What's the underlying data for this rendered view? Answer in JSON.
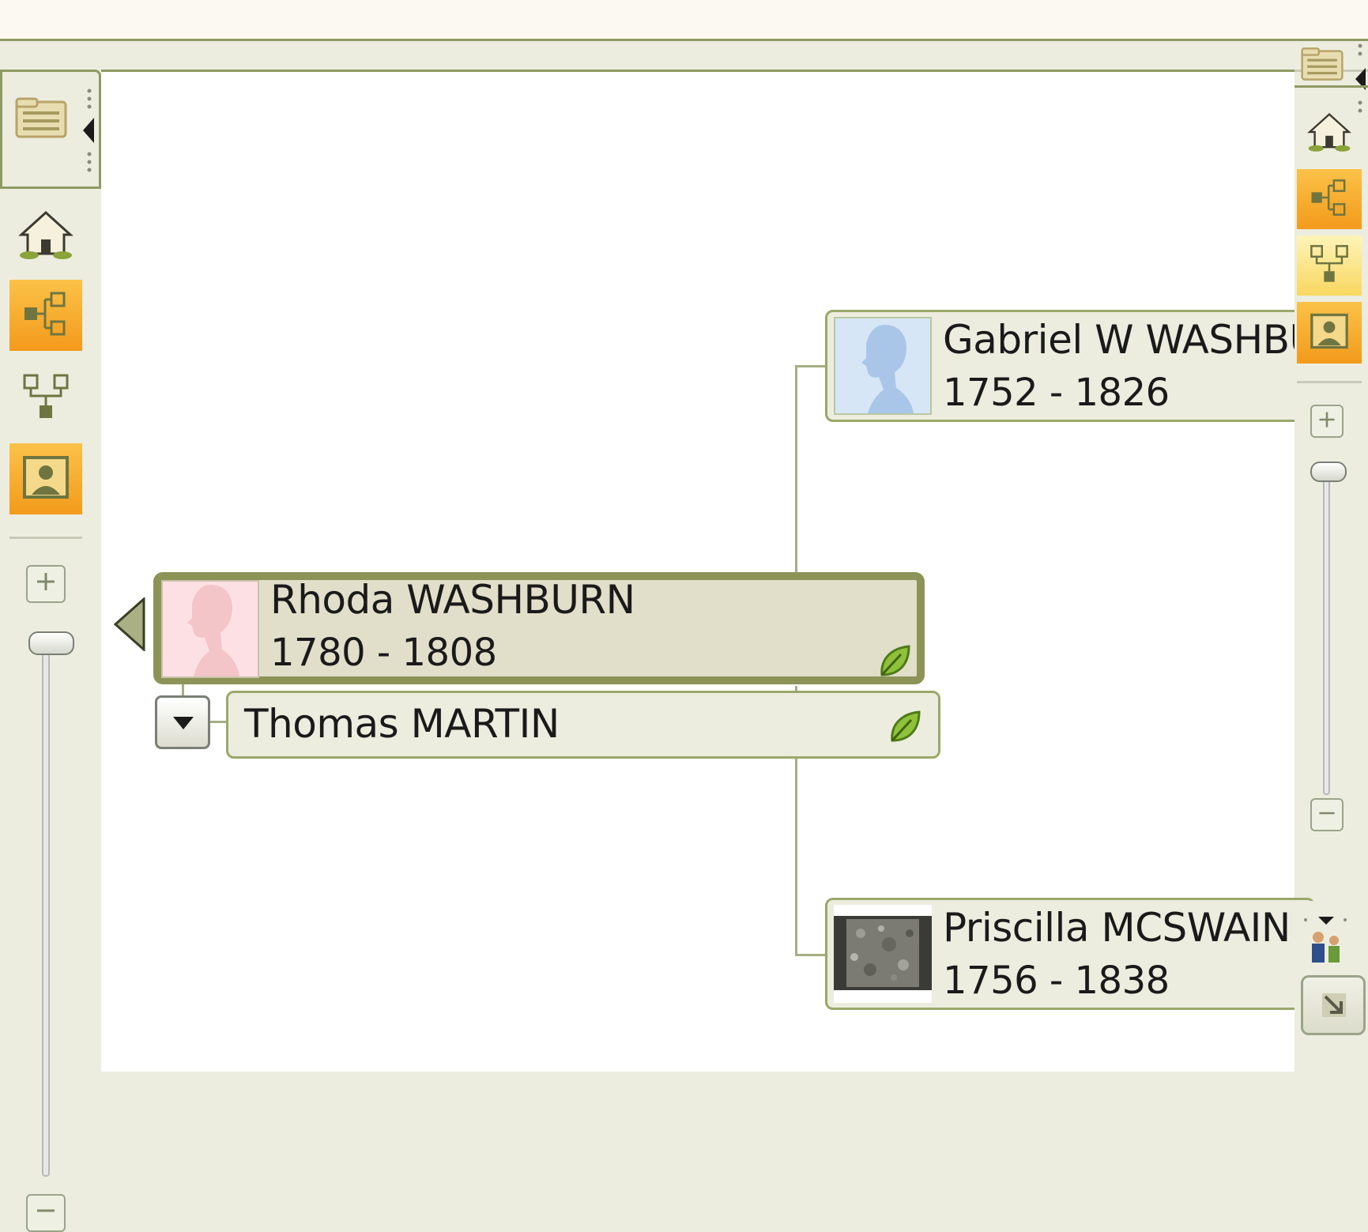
{
  "people": {
    "focus": {
      "name": "Rhoda WASHBURN",
      "dates": "1780 - 1808"
    },
    "spouse": {
      "name": "Thomas MARTIN"
    },
    "father": {
      "name": "Gabriel W WASHBURN",
      "dates": "1752 - 1826"
    },
    "mother": {
      "name": "Priscilla MCSWAIN",
      "dates": "1756 - 1838"
    }
  },
  "colors": {
    "accent_orange": "#f39a1b",
    "border_green": "#8e9a63",
    "male_silhouette": "#a9c6e8",
    "female_silhouette": "#f3c4c8"
  }
}
